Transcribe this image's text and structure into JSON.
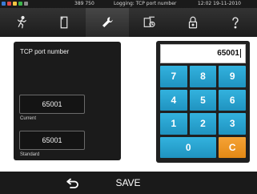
{
  "status_bar": {
    "counter": "389 750",
    "logging": "Logging: TCP port number",
    "clock": "12:02  19-11-2010",
    "indicator_colors": [
      "#3a7bd5",
      "#e04848",
      "#f5c542",
      "#3cb44b",
      "#8a8a8a"
    ]
  },
  "toolbar": {
    "tools": [
      {
        "name": "program",
        "icon": "running-man-icon"
      },
      {
        "name": "documents",
        "icon": "document-icon"
      },
      {
        "name": "settings",
        "icon": "wrench-icon",
        "active": true
      },
      {
        "name": "rotation",
        "icon": "rotate-document-icon"
      },
      {
        "name": "lock",
        "icon": "lock-icon"
      },
      {
        "name": "help",
        "icon": "question-mark-icon"
      }
    ]
  },
  "panel": {
    "title": "TCP port number",
    "current_value": "65001",
    "current_label": "Current",
    "standard_value": "65001",
    "standard_label": "Standard"
  },
  "keypad": {
    "display_value": "65001",
    "keys": [
      "7",
      "8",
      "9",
      "4",
      "5",
      "6",
      "1",
      "2",
      "3",
      "0",
      "C"
    ],
    "key_color": "#29a6d4",
    "clear_color": "#ef9a2a"
  },
  "bottom_bar": {
    "back_icon": "return-arrow-icon",
    "save_label": "SAVE"
  }
}
